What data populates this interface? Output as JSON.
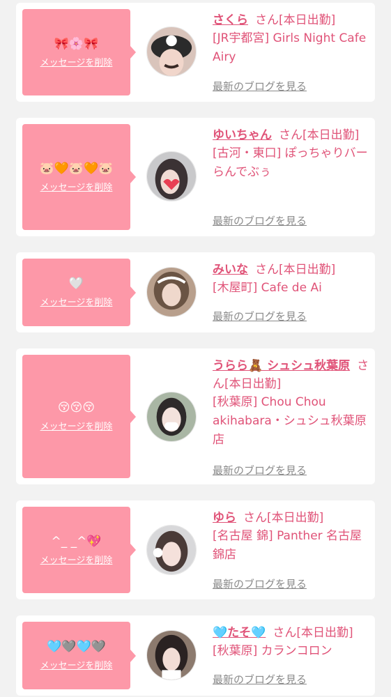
{
  "delete_label": "メッセージを削除",
  "blog_label": "最新のブログを見る",
  "colors": {
    "accent": "#e05378",
    "bubble": "#fd98a8",
    "link_gray": "#8a8a8a",
    "background": "#f2f2f2"
  },
  "messages": [
    {
      "emoji": "🎀🌸🎀",
      "name": "さくら",
      "honorific": "さん",
      "status": "[本日出勤]",
      "location": "[JR宇都宮] Girls Night Cafe Airy"
    },
    {
      "emoji": "🐷🧡🐷🧡🐷",
      "name": "ゆいちゃん",
      "honorific": "さん",
      "status": "[本日出勤]",
      "location": "[古河・東口] ぽっちゃりバー らんでぶぅ"
    },
    {
      "emoji": "🤍",
      "name": "みいな",
      "honorific": "さん",
      "status": "[本日出勤]",
      "location": "[木屋町] Cafe de Ai"
    },
    {
      "emoji": "😚😚😚",
      "name": "うらら🧸 シュシュ秋葉原",
      "honorific": "さん",
      "status": "[本日出勤]",
      "location": "[秋葉原] Chou Chou akihabara・シュシュ秋葉原店"
    },
    {
      "emoji": "^_ _^💖",
      "name": "ゆら",
      "honorific": "さん",
      "status": "[本日出勤]",
      "location": "[名古屋 錦] Panther 名古屋錦店"
    },
    {
      "emoji": "🩵🩶🩵🩶",
      "name": "🩵たそ🩵",
      "honorific": "さん",
      "status": "[本日出勤]",
      "location": "[秋葉原] カランコロン"
    }
  ]
}
